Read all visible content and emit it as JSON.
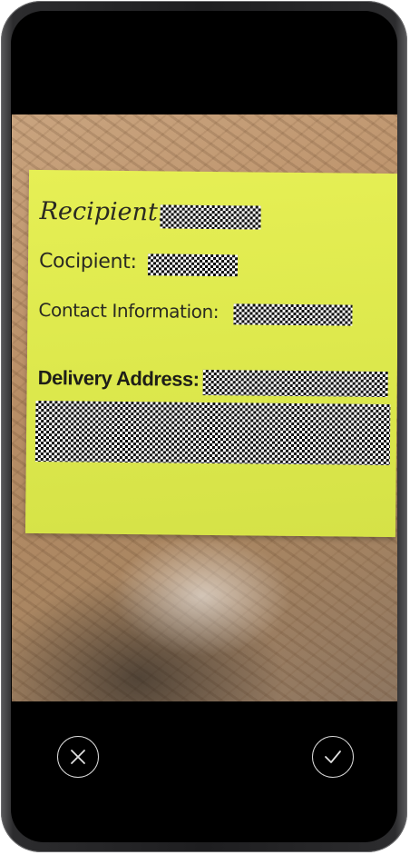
{
  "note": {
    "recipient_label": "Recipient:",
    "cocipient_label": "Cocipient:",
    "contact_label": "Contact Information:",
    "delivery_label": "Delivery Address:"
  },
  "controls": {
    "cancel_icon": "close-icon",
    "confirm_icon": "checkmark-icon"
  },
  "colors": {
    "note_yellow": "#dfea4e",
    "screen_background": "#000000",
    "button_outline": "#d8d8d8"
  }
}
